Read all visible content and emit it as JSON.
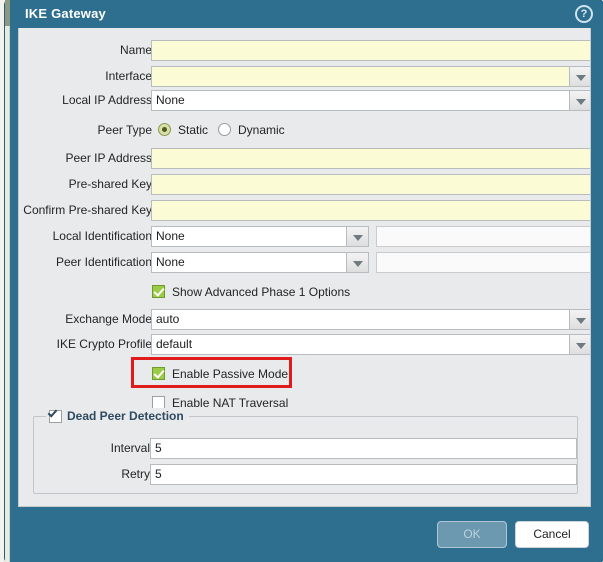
{
  "window": {
    "title": "IKE Gateway",
    "help_icon": "help-circle-icon"
  },
  "form": {
    "rows": [
      {
        "label": "Name",
        "value": "",
        "type": "text"
      },
      {
        "label": "Interface",
        "value": "",
        "type": "dropdown"
      },
      {
        "label": "Local IP Address",
        "value": "None",
        "type": "dropdown"
      },
      {
        "label": "Peer Type",
        "value": "",
        "type": "radio"
      },
      {
        "label": "Peer IP Address",
        "value": "",
        "type": "text"
      },
      {
        "label": "Pre-shared Key",
        "value": "",
        "type": "text"
      },
      {
        "label": "Confirm Pre-shared Key",
        "value": "",
        "type": "text"
      },
      {
        "label": "Local Identification",
        "value": "None",
        "type": "dropdown-pair"
      },
      {
        "label": "Peer Identification",
        "value": "None",
        "type": "dropdown-pair"
      },
      {
        "label": "Exchange Mode",
        "value": "auto",
        "type": "dropdown"
      },
      {
        "label": "IKE Crypto Profile",
        "value": "default",
        "type": "dropdown"
      }
    ],
    "peer_type": {
      "label": "Peer Type",
      "options": [
        {
          "label": "Static",
          "selected": true
        },
        {
          "label": "Dynamic",
          "selected": false
        }
      ]
    },
    "checkboxes": [
      {
        "label": "Show Advanced Phase 1 Options",
        "checked": true,
        "style": "green"
      },
      {
        "label": "Enable Passive Mode",
        "checked": true,
        "style": "green",
        "highlighted": true
      },
      {
        "label": "Enable NAT Traversal",
        "checked": false,
        "style": "plain"
      }
    ],
    "local_identification_value": "",
    "peer_identification_value": ""
  },
  "dead_peer_detection": {
    "legend": "Dead Peer Detection",
    "checked": true,
    "fields": [
      {
        "label": "Interval",
        "value": "5"
      },
      {
        "label": "Retry",
        "value": "5"
      }
    ]
  },
  "footer": {
    "ok_label": "OK",
    "cancel_label": "Cancel"
  },
  "colors": {
    "titlebar": "#2e6e8e",
    "panel": "#e9eaec",
    "input_yellow": "#fbfbd5",
    "checkbox_green": "#9ccb47",
    "highlight_red": "#e01b1b",
    "legend_navy": "#2d4a60"
  }
}
